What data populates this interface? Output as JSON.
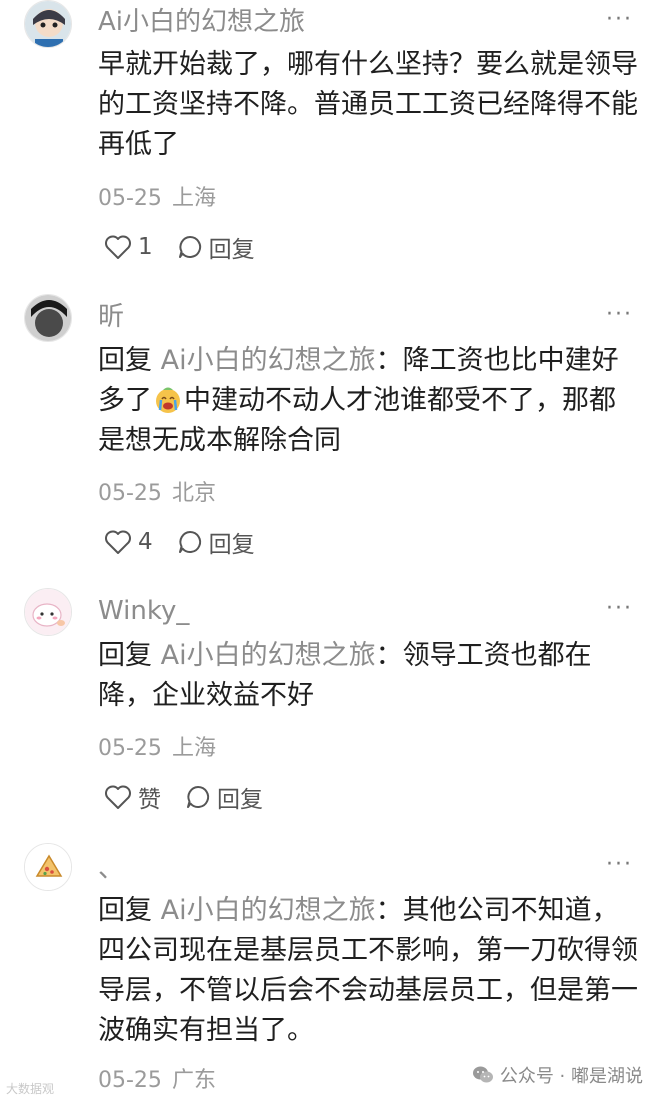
{
  "more_label": "···",
  "reply_action_label": "回复",
  "comments": [
    {
      "username": "Ai小白的幻想之旅",
      "text": "早就开始裁了，哪有什么坚持？要么就是领导的工资坚持不降。普通员工工资已经降得不能再低了",
      "date": "05-25",
      "location": "上海",
      "likes": "1"
    },
    {
      "username": "昕",
      "reply_prefix": "回复",
      "reply_target": "Ai小白的幻想之旅",
      "text_before_emoji": "：降工资也比中建好多了",
      "emoji": "crying-face-emoji",
      "text_after_emoji": "中建动不动人才池谁都受不了，那都是想无成本解除合同",
      "date": "05-25",
      "location": "北京",
      "likes": "4"
    },
    {
      "username": "Winky_",
      "reply_prefix": "回复",
      "reply_target": "Ai小白的幻想之旅",
      "text": "：领导工资也都在降，企业效益不好",
      "date": "05-25",
      "location": "上海",
      "likes": "赞"
    },
    {
      "username": "、",
      "reply_prefix": "回复",
      "reply_target": "Ai小白的幻想之旅",
      "text": "：其他公司不知道，四公司现在是基层员工不影响，第一刀砍得领导层，不管以后会不会动基层员工，但是第一波确实有担当了。",
      "date": "05-25",
      "location": "广东"
    }
  ],
  "watermark": {
    "left": "大数据观",
    "right": "公众号 · 嘟是湖说"
  },
  "colors": {
    "username": "#8c8c8c",
    "body_text": "#1f1f1f",
    "meta": "#9b9b9b"
  }
}
